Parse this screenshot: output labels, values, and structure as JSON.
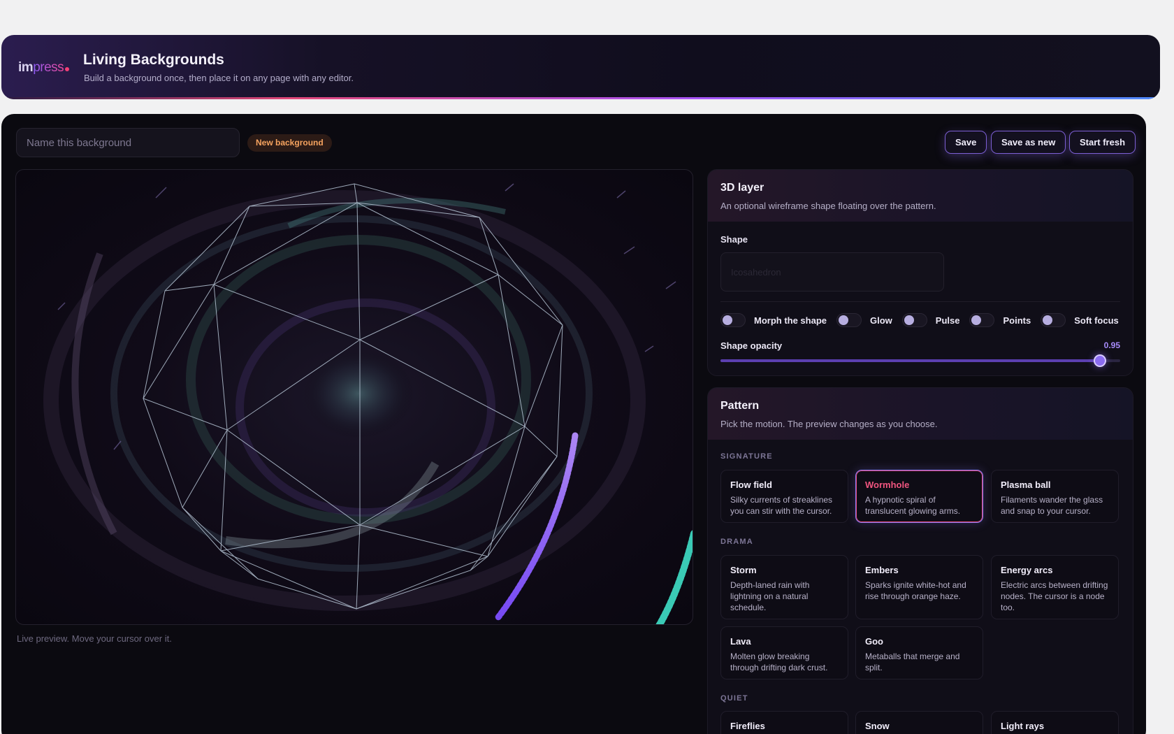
{
  "header": {
    "logo_im": "im",
    "logo_press": "press",
    "title": "Living Backgrounds",
    "subtitle": "Build a background once, then place it on any page with any editor."
  },
  "editor": {
    "name_placeholder": "Name this background",
    "name_value": "",
    "status_badge": "New background",
    "buttons": {
      "save": "Save",
      "save_as_new": "Save as new",
      "start_fresh": "Start fresh"
    },
    "preview_caption": "Live preview. Move your cursor over it."
  },
  "layer3d": {
    "title": "3D layer",
    "subtitle": "An optional wireframe shape floating over the pattern.",
    "shape_label": "Shape",
    "shape_value": "Icosahedron",
    "toggles": [
      {
        "label": "Morph the shape",
        "on": false
      },
      {
        "label": "Glow",
        "on": false
      },
      {
        "label": "Pulse",
        "on": false
      },
      {
        "label": "Points",
        "on": false
      },
      {
        "label": "Soft focus",
        "on": false
      }
    ],
    "opacity_label": "Shape opacity",
    "opacity_value": "0.95",
    "opacity_fraction": 0.95
  },
  "pattern": {
    "title": "Pattern",
    "subtitle": "Pick the motion. The preview changes as you choose.",
    "groups": [
      {
        "label": "SIGNATURE",
        "items": [
          {
            "title": "Flow field",
            "desc": "Silky currents of streaklines you can stir with the cursor."
          },
          {
            "title": "Wormhole",
            "desc": "A hypnotic spiral of translucent glowing arms.",
            "selected": true
          },
          {
            "title": "Plasma ball",
            "desc": "Filaments wander the glass and snap to your cursor."
          }
        ]
      },
      {
        "label": "DRAMA",
        "items": [
          {
            "title": "Storm",
            "desc": "Depth-laned rain with lightning on a natural schedule."
          },
          {
            "title": "Embers",
            "desc": "Sparks ignite white-hot and rise through orange haze."
          },
          {
            "title": "Energy arcs",
            "desc": "Electric arcs between drifting nodes. The cursor is a node too."
          },
          {
            "title": "Lava",
            "desc": "Molten glow breaking through drifting dark crust."
          },
          {
            "title": "Goo",
            "desc": "Metaballs that merge and split."
          }
        ]
      },
      {
        "label": "QUIET",
        "items": [
          {
            "title": "Fireflies",
            "desc": ""
          },
          {
            "title": "Snow",
            "desc": ""
          },
          {
            "title": "Light rays",
            "desc": ""
          }
        ]
      }
    ]
  },
  "colors": {
    "accent": "#8b6cf0",
    "selected_title": "#f0557f",
    "badge_text": "#f6a35f"
  }
}
